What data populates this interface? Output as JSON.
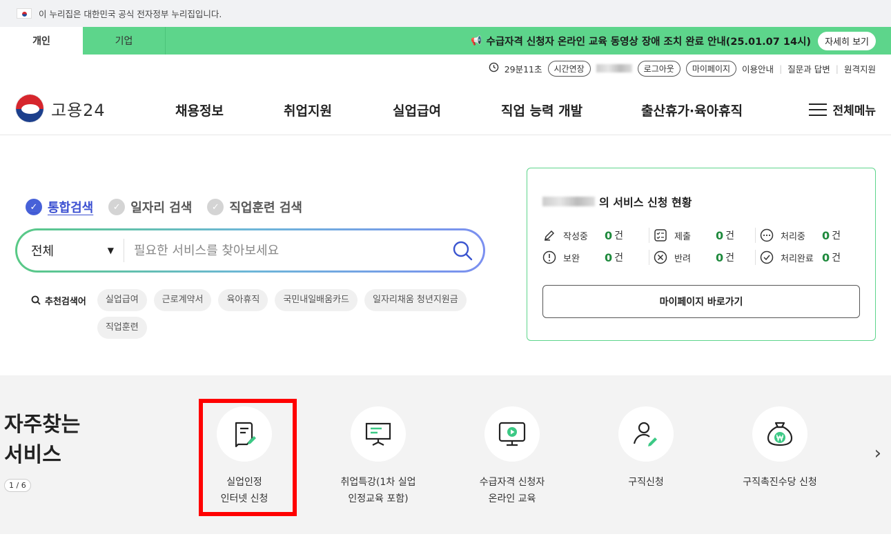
{
  "gov_banner": {
    "text": "이 누리집은 대한민국 공식 전자정부 누리집입니다."
  },
  "tabs": [
    {
      "label": "개인"
    },
    {
      "label": "기업"
    }
  ],
  "notice": {
    "text": "수급자격 신청자 온라인 교육 동영상 장애 조치 완료 안내(25.01.07 14시)",
    "button": "자세히 보기"
  },
  "util": {
    "timer": "29분11초",
    "extend": "시간연장",
    "logout": "로그아웃",
    "mypage": "마이페이지",
    "links": [
      "이용안내",
      "질문과 답변",
      "원격지원"
    ]
  },
  "logo": {
    "text": "고용24"
  },
  "gnb": [
    "채용정보",
    "취업지원",
    "실업급여",
    "직업 능력 개발",
    "출산휴가·육아휴직"
  ],
  "menu_all": "전체메뉴",
  "search": {
    "tabs": [
      "통합검색",
      "일자리 검색",
      "직업훈련 검색"
    ],
    "select": "전체",
    "placeholder": "필요한 서비스를 찾아보세요",
    "rec_label": "추천검색어",
    "rec_tags": [
      "실업급여",
      "근로계약서",
      "육아휴직",
      "국민내일배움카드",
      "일자리채움 청년지원금",
      "직업훈련"
    ]
  },
  "status": {
    "title_suffix": "의 서비스 신청 현황",
    "items": [
      {
        "label": "작성중",
        "count": "0",
        "unit": "건"
      },
      {
        "label": "제출",
        "count": "0",
        "unit": "건"
      },
      {
        "label": "처리중",
        "count": "0",
        "unit": "건"
      },
      {
        "label": "보완",
        "count": "0",
        "unit": "건"
      },
      {
        "label": "반려",
        "count": "0",
        "unit": "건"
      },
      {
        "label": "처리완료",
        "count": "0",
        "unit": "건"
      }
    ],
    "button": "마이페이지 바로가기"
  },
  "frequent": {
    "title": "자주찾는\n서비스",
    "pager": "1 / 6",
    "items": [
      {
        "label": "실업인정\n인터넷 신청"
      },
      {
        "label": "취업특강(1차 실업\n인정교육 포함)"
      },
      {
        "label": "수급자격 신청자\n온라인 교육"
      },
      {
        "label": "구직신청"
      },
      {
        "label": "구직촉진수당 신청"
      }
    ]
  },
  "colors": {
    "accent_green": "#5dd58b",
    "accent_blue": "#4761d8",
    "highlight": "#ff0000"
  }
}
